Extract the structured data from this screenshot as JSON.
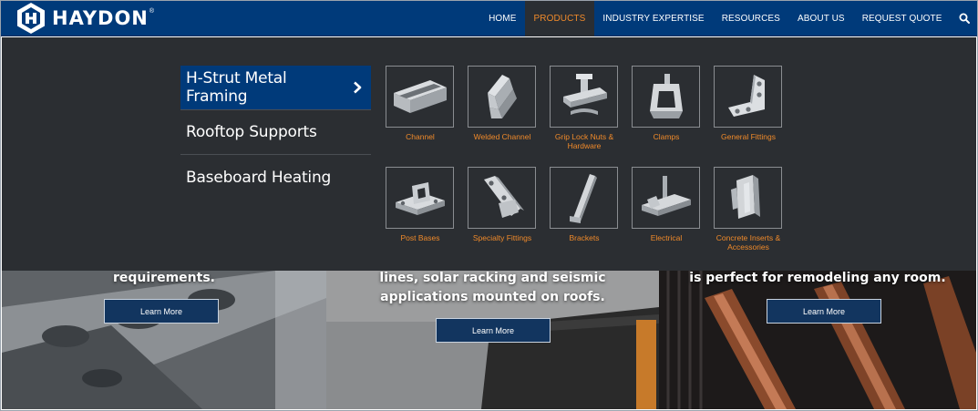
{
  "brand": {
    "name": "HAYDON",
    "reg_mark": "®"
  },
  "nav": {
    "items": [
      "HOME",
      "PRODUCTS",
      "INDUSTRY EXPERTISE",
      "RESOURCES",
      "ABOUT US",
      "REQUEST QUOTE"
    ],
    "active": "PRODUCTS",
    "search_icon": "search-icon"
  },
  "menu": {
    "categories": [
      {
        "label": "H-Strut Metal Framing",
        "active": true
      },
      {
        "label": "Rooftop Supports",
        "active": false
      },
      {
        "label": "Baseboard Heating",
        "active": false
      }
    ],
    "products": [
      {
        "label": "Channel",
        "icon": "channel-icon"
      },
      {
        "label": "Welded Channel",
        "icon": "welded-channel-icon"
      },
      {
        "label": "Grip Lock Nuts & Hardware",
        "icon": "grip-lock-nut-icon"
      },
      {
        "label": "Clamps",
        "icon": "clamp-icon"
      },
      {
        "label": "General Fittings",
        "icon": "general-fitting-icon"
      },
      {
        "label": "Post Bases",
        "icon": "post-base-icon"
      },
      {
        "label": "Specialty Fittings",
        "icon": "specialty-fitting-icon"
      },
      {
        "label": "Brackets",
        "icon": "bracket-icon"
      },
      {
        "label": "Electrical",
        "icon": "electrical-icon"
      },
      {
        "label": "Concrete Inserts & Accessories",
        "icon": "concrete-insert-icon"
      }
    ]
  },
  "heroes": [
    {
      "text_lines": [
        "requirements."
      ],
      "button": "Learn More"
    },
    {
      "text_lines": [
        "lines, solar racking and seismic",
        "applications mounted on roofs."
      ],
      "button": "Learn More"
    },
    {
      "text_lines": [
        "is perfect for remodeling any room."
      ],
      "button": "Learn More"
    }
  ],
  "colors": {
    "nav_bg": "#003a7a",
    "accent": "#f08a2a",
    "menu_bg": "#2b2e32",
    "button_bg": "#12355f"
  }
}
